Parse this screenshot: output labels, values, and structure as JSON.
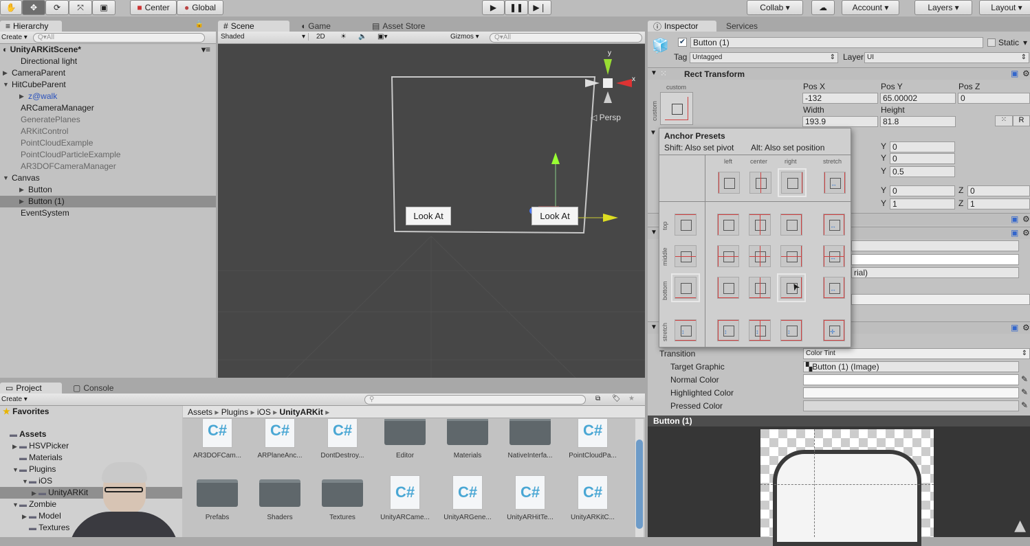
{
  "toolbar": {
    "tools": [
      "hand-tool",
      "move-tool",
      "rotate-tool",
      "scale-tool",
      "rect-tool"
    ],
    "active_tool": "move-tool",
    "pivot": "Center",
    "space": "Global",
    "collab": "Collab ▾",
    "account": "Account ▾",
    "layers": "Layers ▾",
    "layout": "Layout ▾"
  },
  "hierarchy": {
    "tab": "Hierarchy",
    "create": "Create ▾",
    "search_placeholder": "Q▾All",
    "scene": "UnityARKitScene*",
    "items": [
      {
        "label": "Directional light",
        "indent": 1,
        "arrow": false,
        "style": "normal"
      },
      {
        "label": "CameraParent",
        "indent": 0,
        "arrow": "▶",
        "style": "normal"
      },
      {
        "label": "HitCubeParent",
        "indent": 0,
        "arrow": "▼",
        "style": "normal"
      },
      {
        "label": "z@walk",
        "indent": 2,
        "arrow": "▶",
        "style": "blue"
      },
      {
        "label": "ARCameraManager",
        "indent": 1,
        "arrow": false,
        "style": "normal"
      },
      {
        "label": "GeneratePlanes",
        "indent": 1,
        "arrow": false,
        "style": "grey"
      },
      {
        "label": "ARKitControl",
        "indent": 1,
        "arrow": false,
        "style": "grey"
      },
      {
        "label": "PointCloudExample",
        "indent": 1,
        "arrow": false,
        "style": "grey"
      },
      {
        "label": "PointCloudParticleExample",
        "indent": 1,
        "arrow": false,
        "style": "grey"
      },
      {
        "label": "AR3DOFCameraManager",
        "indent": 1,
        "arrow": false,
        "style": "grey"
      },
      {
        "label": "Canvas",
        "indent": 0,
        "arrow": "▼",
        "style": "normal"
      },
      {
        "label": "Button",
        "indent": 2,
        "arrow": "▶",
        "style": "normal"
      },
      {
        "label": "Button (1)",
        "indent": 2,
        "arrow": "▶",
        "style": "selected"
      },
      {
        "label": "EventSystem",
        "indent": 1,
        "arrow": false,
        "style": "normal"
      }
    ]
  },
  "scene": {
    "tabs": [
      "Scene",
      "Game",
      "Asset Store"
    ],
    "active_tab": "Scene",
    "shading": "Shaded",
    "mode_2d": "2D",
    "gizmos": "Gizmos ▾",
    "search_placeholder": "Q▾All",
    "persp": "Persp",
    "gizmo_y": "y",
    "gizmo_x": "x",
    "buttons": [
      "Look At",
      "Look At"
    ]
  },
  "project": {
    "tabs": [
      "Project",
      "Console"
    ],
    "create": "Create ▾",
    "favorites": "Favorites",
    "tree": [
      {
        "label": "Assets",
        "indent": 0,
        "arrow": ""
      },
      {
        "label": "HSVPicker",
        "indent": 1,
        "arrow": "▶"
      },
      {
        "label": "Materials",
        "indent": 1,
        "arrow": ""
      },
      {
        "label": "Plugins",
        "indent": 1,
        "arrow": "▼"
      },
      {
        "label": "iOS",
        "indent": 2,
        "arrow": "▼"
      },
      {
        "label": "UnityARKit",
        "indent": 3,
        "arrow": "▶"
      },
      {
        "label": "Zombie",
        "indent": 1,
        "arrow": "▼"
      },
      {
        "label": "Model",
        "indent": 2,
        "arrow": "▶"
      },
      {
        "label": "Textures",
        "indent": 2,
        "arrow": ""
      }
    ],
    "breadcrumb": [
      "Assets",
      "Plugins",
      "iOS",
      "UnityARKit"
    ],
    "assets": [
      {
        "name": "AR3DOFCam...",
        "type": "cs"
      },
      {
        "name": "ARPlaneAnc...",
        "type": "cs"
      },
      {
        "name": "DontDestroy...",
        "type": "cs"
      },
      {
        "name": "Editor",
        "type": "folder"
      },
      {
        "name": "Materials",
        "type": "folder"
      },
      {
        "name": "NativeInterfa...",
        "type": "folder"
      },
      {
        "name": "PointCloudPa...",
        "type": "cs"
      },
      {
        "name": "Prefabs",
        "type": "folder"
      },
      {
        "name": "Shaders",
        "type": "folder"
      },
      {
        "name": "Textures",
        "type": "folder"
      },
      {
        "name": "UnityARCame...",
        "type": "cs"
      },
      {
        "name": "UnityARGene...",
        "type": "cs"
      },
      {
        "name": "UnityARHitTe...",
        "type": "cs"
      },
      {
        "name": "UnityARKitC...",
        "type": "cs"
      }
    ]
  },
  "inspector": {
    "tabs": [
      "Inspector",
      "Services"
    ],
    "object_name": "Button (1)",
    "active": true,
    "static_label": "Static",
    "static": false,
    "tag_label": "Tag",
    "tag": "Untagged",
    "layer_label": "Layer",
    "layer": "UI",
    "rect_transform": {
      "title": "Rect Transform",
      "anchor_label": "custom",
      "pos_x_label": "Pos X",
      "pos_y_label": "Pos Y",
      "pos_z_label": "Pos Z",
      "pos_x": "-132",
      "pos_y": "65.00002",
      "pos_z": "0",
      "width_label": "Width",
      "height_label": "Height",
      "width": "193.9",
      "height": "81.8",
      "r_button": "R",
      "y_label": "Y",
      "z_label": "Z",
      "anchor_min_y": "0",
      "anchor_max_y": "0",
      "pivot_y": "0.5",
      "rotation_y": "0",
      "rotation_z": "0",
      "scale_y": "1",
      "scale_z": "1"
    },
    "image_partial": "rial)",
    "button": {
      "transition_label": "Transition",
      "transition": "Color Tint",
      "target_graphic_label": "Target Graphic",
      "target_graphic": "Button (1) (Image)",
      "normal_label": "Normal Color",
      "highlighted_label": "Highlighted Color",
      "pressed_label": "Pressed Color"
    },
    "preview_title": "Button (1)"
  },
  "anchor_presets": {
    "title": "Anchor Presets",
    "hint_shift": "Shift: Also set pivot",
    "hint_alt": "Alt: Also set position",
    "columns": [
      "left",
      "center",
      "right",
      "stretch"
    ],
    "rows": [
      "top",
      "middle",
      "bottom",
      "stretch"
    ]
  },
  "colors": {
    "scene_bg": "#474747",
    "selection": "#8f8f8f",
    "anchor_red": "#d04040"
  }
}
